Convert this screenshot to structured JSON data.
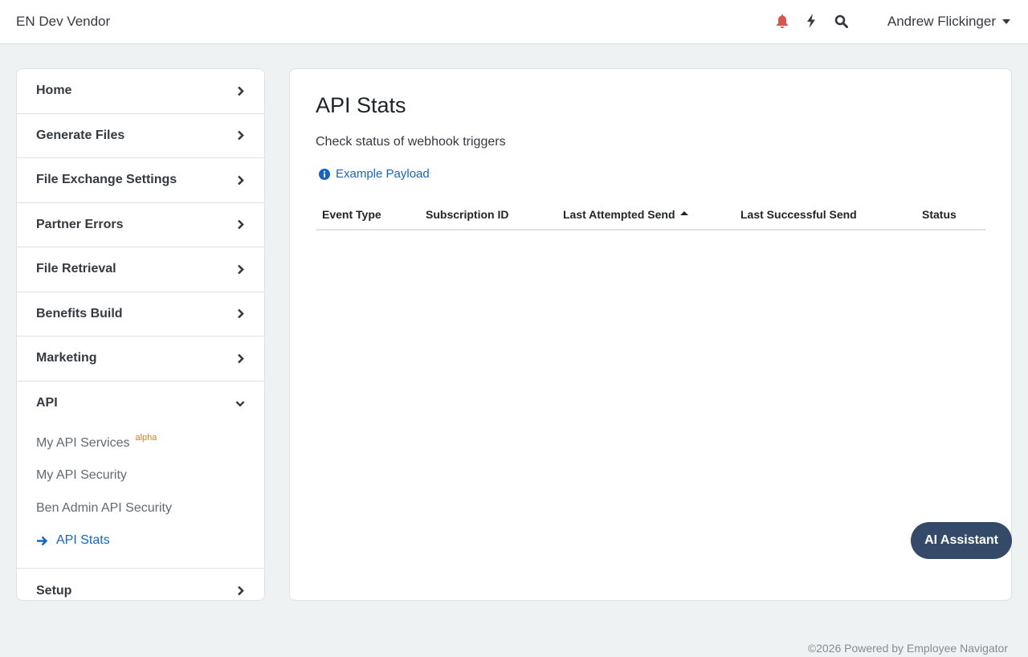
{
  "header": {
    "brand": "EN Dev Vendor",
    "user_name": "Andrew Flickinger",
    "icons": [
      "bell-icon",
      "bolt-icon",
      "search-icon"
    ],
    "bell_color": "#d9534f"
  },
  "sidebar": {
    "items": [
      {
        "label": "Home"
      },
      {
        "label": "Generate Files"
      },
      {
        "label": "File Exchange Settings"
      },
      {
        "label": "Partner Errors"
      },
      {
        "label": "File Retrieval"
      },
      {
        "label": "Benefits Build"
      },
      {
        "label": "Marketing"
      },
      {
        "label": "API",
        "expanded": true
      },
      {
        "label": "Setup"
      }
    ],
    "api_subitems": [
      {
        "label": "My API Services",
        "badge": "alpha"
      },
      {
        "label": "My API Security"
      },
      {
        "label": "Ben Admin API Security"
      },
      {
        "label": "API Stats",
        "active": true
      }
    ]
  },
  "main": {
    "title": "API Stats",
    "subtitle": "Check status of webhook triggers",
    "payload_link": "Example Payload",
    "table": {
      "columns": [
        "Event Type",
        "Subscription ID",
        "Last Attempted Send",
        "Last Successful Send",
        "Status"
      ],
      "sorted_column": "Last Attempted Send",
      "sort_direction": "ascending",
      "rows": []
    }
  },
  "ai_assistant": {
    "label": "AI Assistant"
  },
  "footer": {
    "text": "©2026 Powered by Employee Navigator"
  },
  "colors": {
    "accent": "#1565c0",
    "ai_button": "#344a68",
    "badge": "#e07b18"
  }
}
